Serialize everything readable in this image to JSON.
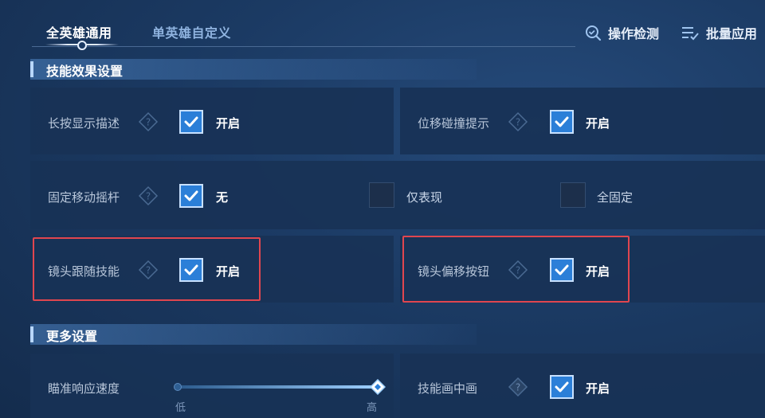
{
  "tabs": [
    {
      "label": "全英雄通用",
      "active": true
    },
    {
      "label": "单英雄自定义",
      "active": false
    }
  ],
  "top_actions": {
    "detect_label": "操作检测",
    "batch_label": "批量应用"
  },
  "sections": {
    "skill_effects": "技能效果设置",
    "more": "更多设置"
  },
  "settings": {
    "long_press": {
      "label": "长按显示描述",
      "option": "开启",
      "checked": true
    },
    "displacement": {
      "label": "位移碰撞提示",
      "option": "开启",
      "checked": true
    },
    "joystick": {
      "label": "固定移动摇杆",
      "options": [
        {
          "label": "无",
          "checked": true
        },
        {
          "label": "仅表现",
          "checked": false
        },
        {
          "label": "全固定",
          "checked": false
        }
      ]
    },
    "camera_follow": {
      "label": "镜头跟随技能",
      "option": "开启",
      "checked": true
    },
    "camera_offset": {
      "label": "镜头偏移按钮",
      "option": "开启",
      "checked": true
    },
    "aim_speed": {
      "label": "瞄准响应速度",
      "min_label": "低",
      "max_label": "高",
      "value": 1.0
    },
    "skill_pip": {
      "label": "技能画中画",
      "option": "开启",
      "checked": true
    }
  },
  "colors": {
    "accent": "#2b7fd8",
    "highlight": "#e0464f"
  }
}
